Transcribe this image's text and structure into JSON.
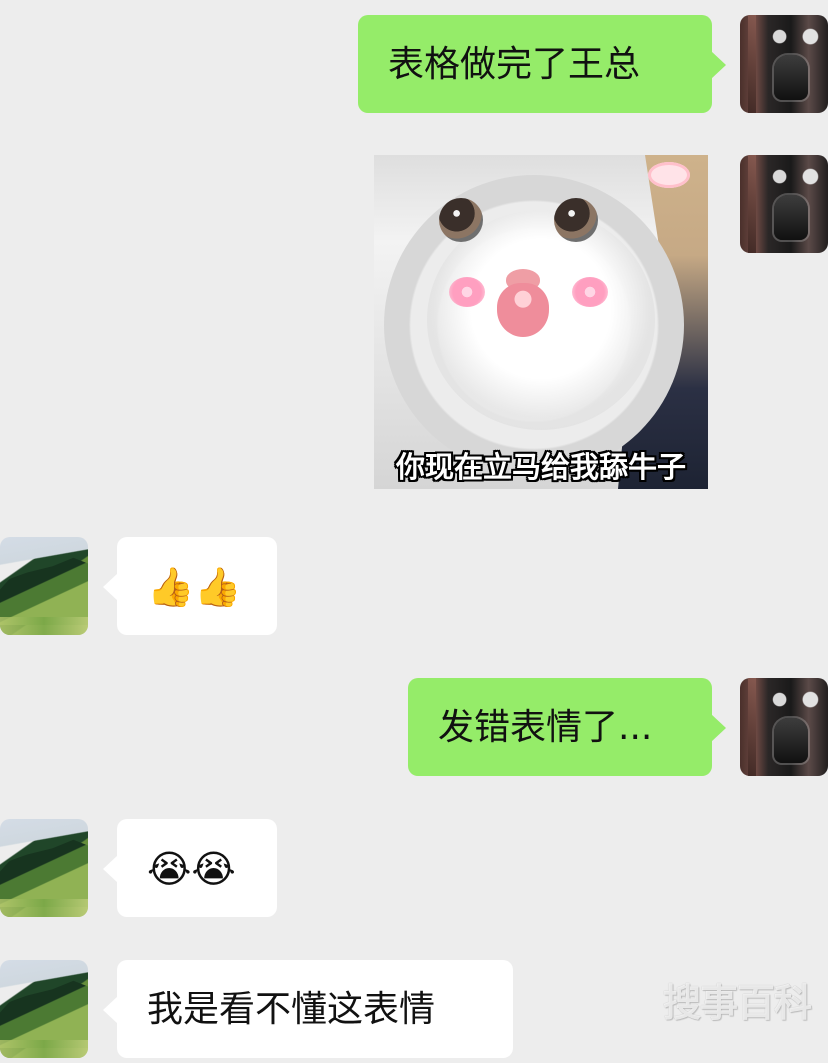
{
  "messages": [
    {
      "sender": "me",
      "text": "表格做完了王总"
    },
    {
      "sender": "me",
      "sticker_caption": "你现在立马给我舔牛子"
    },
    {
      "sender": "friend",
      "text": "👍👍"
    },
    {
      "sender": "me",
      "text": "发错表情了..."
    },
    {
      "sender": "friend",
      "text": "😭😭"
    },
    {
      "sender": "friend",
      "text": "我是看不懂这表情"
    }
  ],
  "watermark": "搜事百科",
  "colors": {
    "background": "#ededed",
    "sent_bubble": "#95ec69",
    "received_bubble": "#ffffff",
    "text": "#111111"
  },
  "icons": {
    "avatar_me": "dark-robot-avatar",
    "avatar_friend": "green-mountain-avatar",
    "sticker": "cat-sticker"
  }
}
